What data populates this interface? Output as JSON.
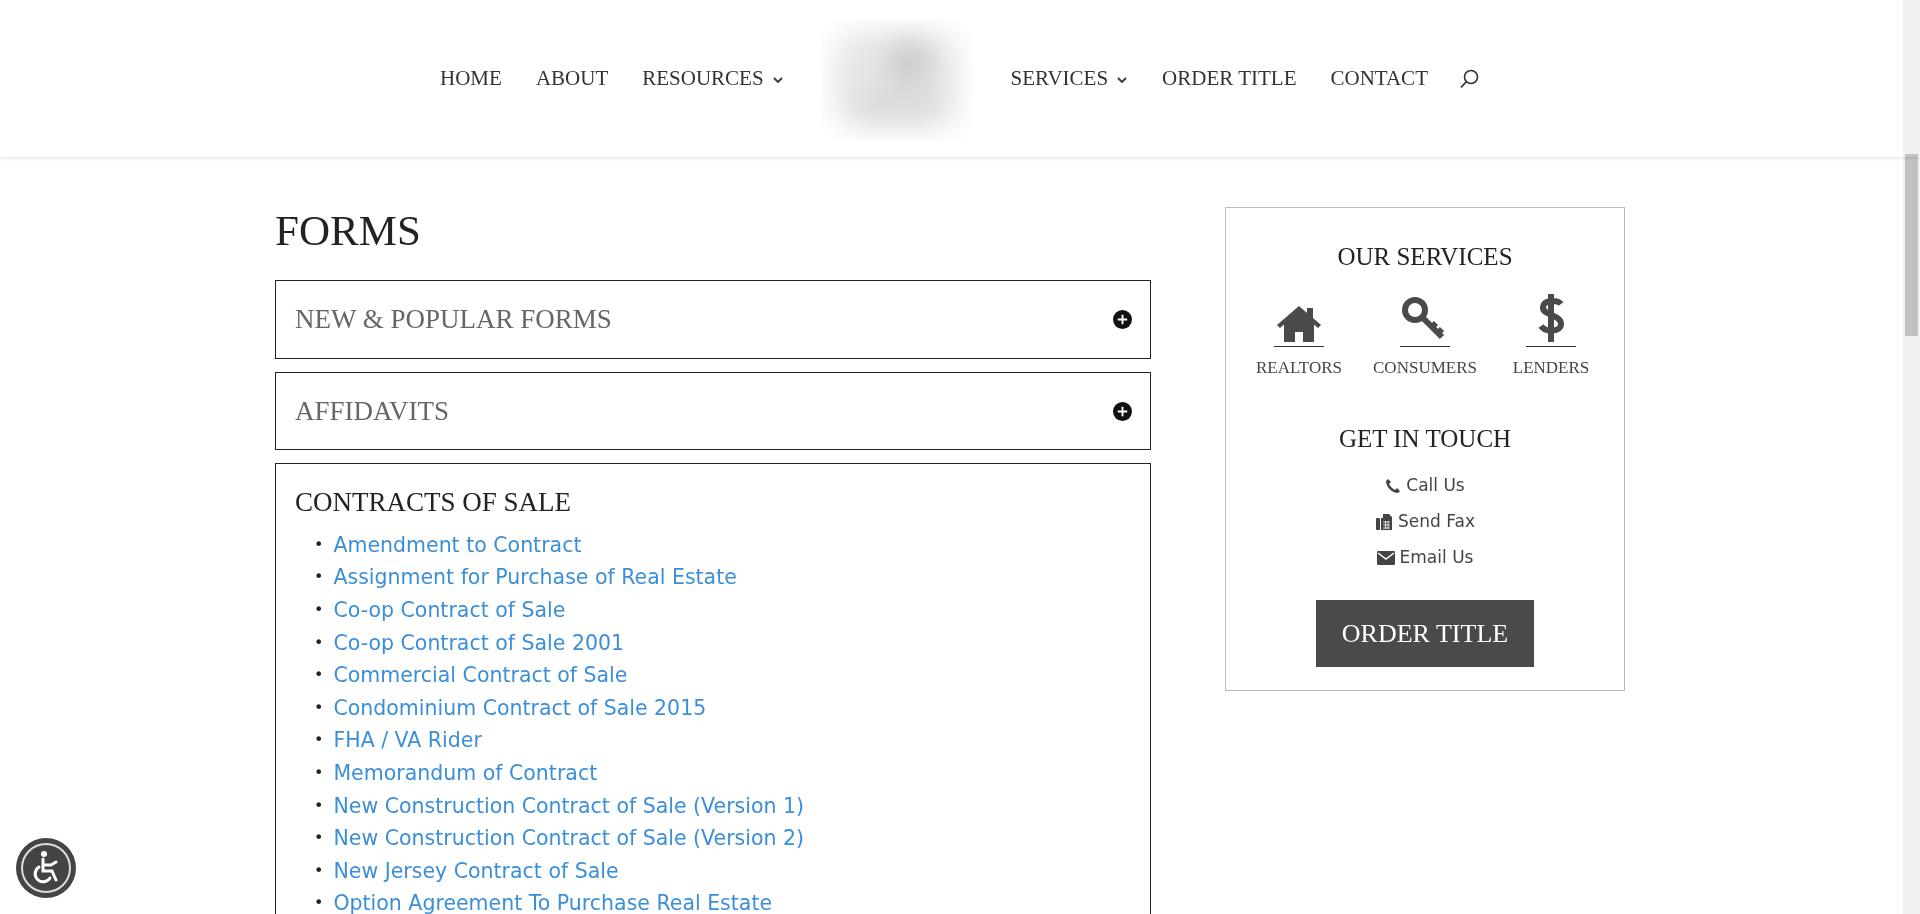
{
  "nav": {
    "left": [
      {
        "label": "HOME",
        "dropdown": false
      },
      {
        "label": "ABOUT",
        "dropdown": false
      },
      {
        "label": "RESOURCES",
        "dropdown": true
      }
    ],
    "right": [
      {
        "label": "SERVICES",
        "dropdown": true
      },
      {
        "label": "ORDER TITLE",
        "dropdown": false
      },
      {
        "label": "CONTACT",
        "dropdown": false
      }
    ]
  },
  "page_title": "FORMS",
  "sections": [
    {
      "title": "NEW & POPULAR FORMS",
      "expanded": false
    },
    {
      "title": "AFFIDAVITS",
      "expanded": false
    },
    {
      "title": "CONTRACTS OF SALE",
      "expanded": true,
      "marker": "•",
      "links": [
        "Amendment to Contract",
        "Assignment for Purchase of Real Estate",
        "Co-op Contract of Sale",
        "Co-op Contract of Sale 2001",
        "Commercial Contract of Sale",
        "Condominium Contract of Sale 2015",
        "FHA / VA Rider",
        "Memorandum of Contract",
        "New Construction Contract of Sale (Version 1)",
        "New Construction Contract of Sale (Version 2)",
        "New Jersey Contract of Sale",
        "Option Agreement To Purchase Real Estate"
      ]
    }
  ],
  "sidebar": {
    "services_title": "OUR SERVICES",
    "services": [
      {
        "kind": "house",
        "label": "REALTORS"
      },
      {
        "kind": "key",
        "label": "CONSUMERS"
      },
      {
        "kind": "dollar",
        "label": "LENDERS"
      }
    ],
    "contact_title": "GET IN TOUCH",
    "contacts": [
      {
        "kind": "phone",
        "label": "Call Us"
      },
      {
        "kind": "fax",
        "label": "Send Fax"
      },
      {
        "kind": "email",
        "label": "Email Us"
      }
    ],
    "button": "ORDER TITLE"
  }
}
